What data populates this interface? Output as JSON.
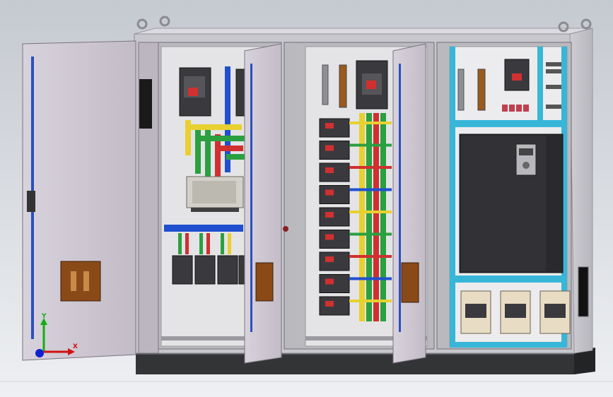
{
  "viewport": {
    "background_top": "#c5c9d0",
    "background_bottom": "#eef0f3"
  },
  "triad": {
    "x_label": "X",
    "y_label": "Y",
    "z_label": "",
    "x_color": "#d01010",
    "y_color": "#10b010",
    "z_color": "#1020d0"
  },
  "model": {
    "description_visible": false,
    "cabinet_color": "#d9d7dc",
    "door_color": "#cfc9d2",
    "base_color": "#333436",
    "mount_plate_color": "#e4e4e6",
    "vfd_color": "#2a2a2e",
    "busbar_colors": [
      "#e8d030",
      "#2aa040",
      "#d03030",
      "#2050d0"
    ],
    "rail_color": "#38b6d8",
    "handle_color": "#9a5a1e",
    "breaker_color": "#3a3a3e"
  }
}
